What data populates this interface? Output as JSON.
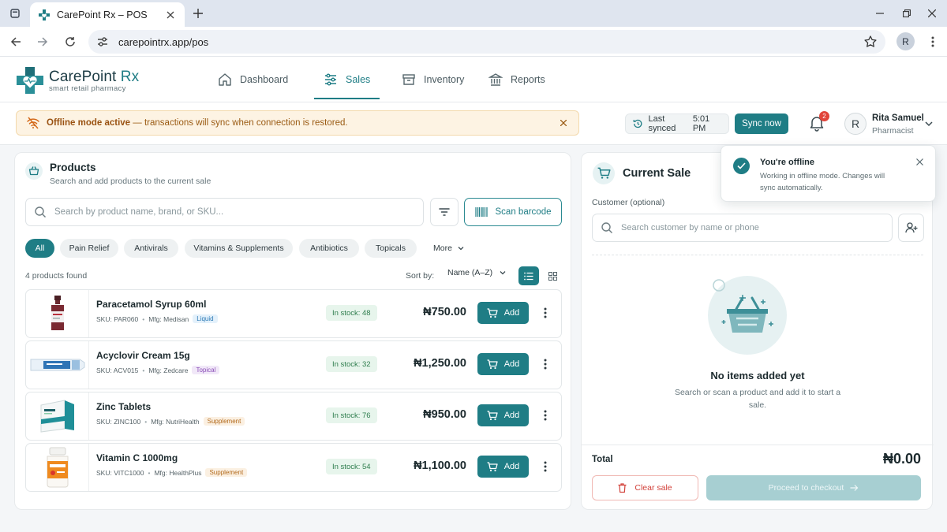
{
  "browser": {
    "tab_title": "CarePoint Rx – POS",
    "url": "carepointrx.app/pos",
    "profile_initial": "R"
  },
  "app": {
    "brand_name": "CarePoint ",
    "brand_accent": "Rx",
    "tagline": "smart retail pharmacy",
    "nav": [
      {
        "label": "Dashboard",
        "icon": "home-icon",
        "active": false
      },
      {
        "label": "Sales",
        "icon": "sliders-icon",
        "active": true
      },
      {
        "label": "Inventory",
        "icon": "box-icon",
        "active": false
      },
      {
        "label": "Reports",
        "icon": "bank-icon",
        "active": false
      }
    ]
  },
  "status": {
    "offline_bold": "Offline mode active",
    "offline_rest": " — transactions will sync when connection is restored.",
    "last_synced_label": "Last synced ",
    "last_synced_time": "5:01 PM",
    "sync_button": "Sync now",
    "notification_count": "2"
  },
  "user": {
    "initial": "R",
    "name": "Rita Samuel",
    "role": "Pharmacist"
  },
  "products": {
    "title": "Products",
    "subtitle": "Search and add products to the current sale",
    "search_placeholder": "Search by product name, brand, or SKU...",
    "scan_label": "Scan barcode",
    "categories": [
      "All",
      "Pain Relief",
      "Antivirals",
      "Vitamins & Supplements",
      "Antibiotics",
      "Topicals"
    ],
    "more_label": "More",
    "found_text": "4 products found",
    "sort_label": "Sort by:",
    "sort_value": "Name (A–Z)",
    "add_label": "Add",
    "items": [
      {
        "name": "Paracetamol Syrup 60ml",
        "sku": "SKU: PAR060",
        "mfg": "Mfg: Medisan",
        "tag": "Liquid",
        "stock": "In stock:  48",
        "price": "₦750.00"
      },
      {
        "name": "Acyclovir Cream 15g",
        "sku": "SKU: ACV015",
        "mfg": "Mfg: Zedcare",
        "tag": "Topical",
        "stock": "In stock:  32",
        "price": "₦1,250.00"
      },
      {
        "name": "Zinc Tablets",
        "sku": "SKU: ZINC100",
        "mfg": "Mfg: NutriHealth",
        "tag": "Supplement",
        "stock": "In stock:  76",
        "price": "₦950.00"
      },
      {
        "name": "Vitamin C 1000mg",
        "sku": "SKU: VITC1000",
        "mfg": "Mfg: HealthPlus",
        "tag": "Supplement",
        "stock": "In stock:  54",
        "price": "₦1,100.00"
      }
    ]
  },
  "sale": {
    "title": "Current Sale",
    "customer_label": "Customer (optional)",
    "customer_placeholder": "Search customer by name or phone",
    "empty_title": "No items added yet",
    "empty_sub": "Search or scan a product and add it to start a sale.",
    "total_label": "Total",
    "total_value": "₦0.00",
    "clear_label": "Clear sale",
    "checkout_label": "Proceed to checkout"
  },
  "toast": {
    "title": "You're offline",
    "message": "Working in offline mode. Changes will sync automatically."
  },
  "colors": {
    "brand": "#1f7d85",
    "warning_bg": "#fdf3e3",
    "danger": "#d2413a",
    "success": "#2e7d4d"
  }
}
